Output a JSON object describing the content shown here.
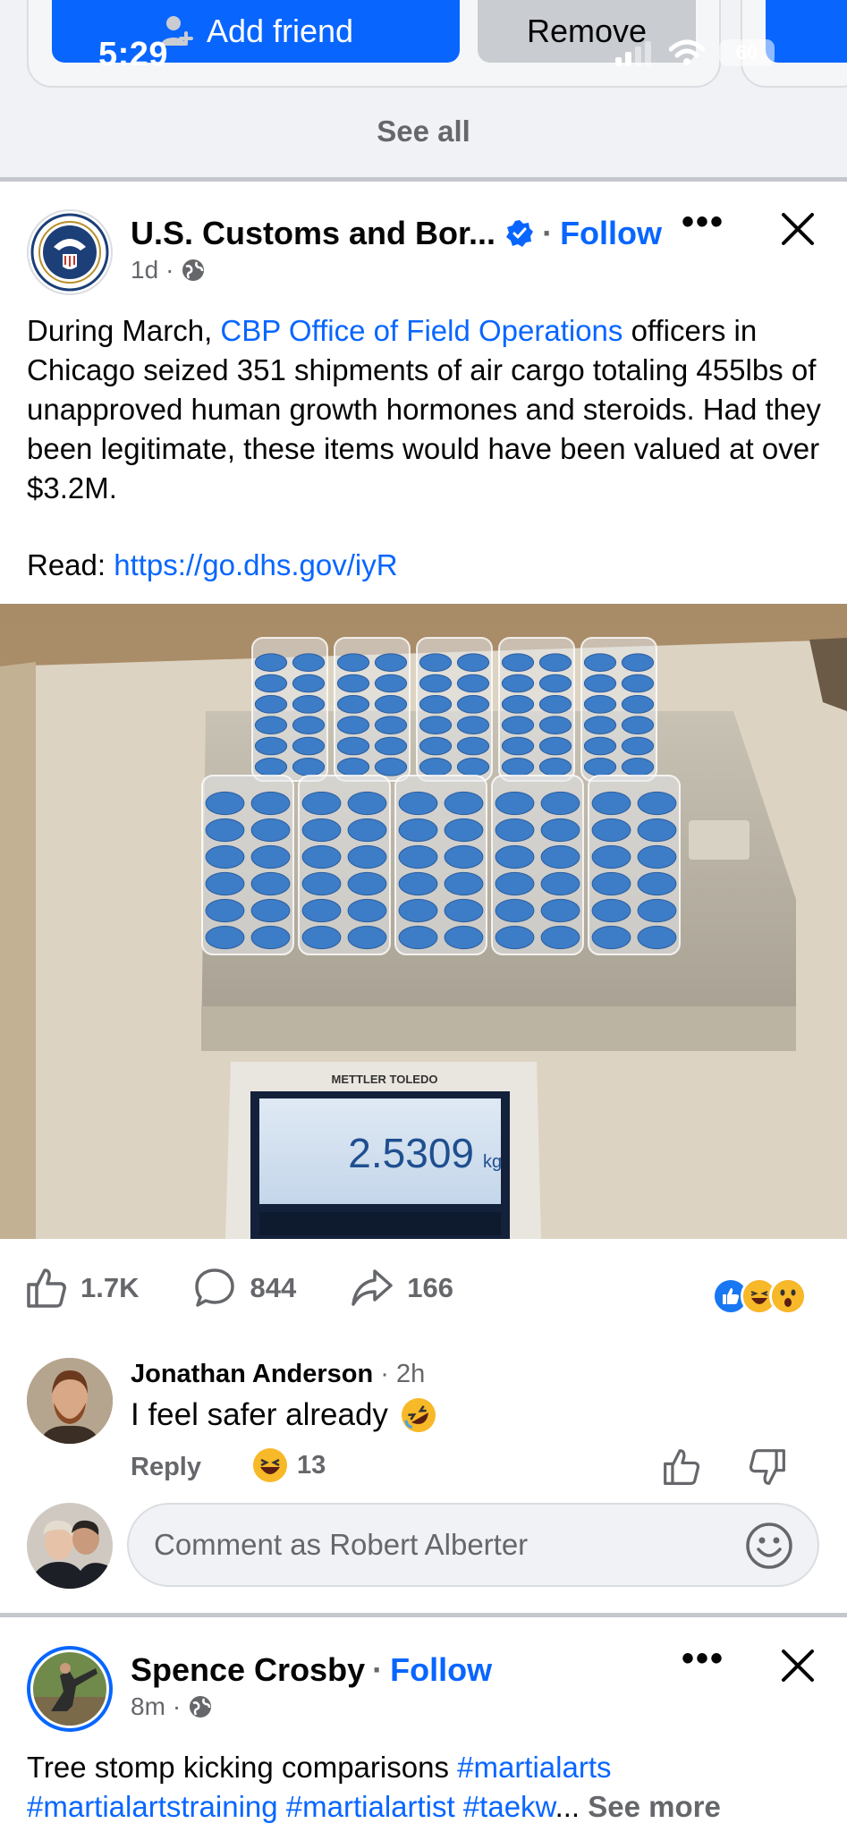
{
  "status_bar": {
    "time": "5:29",
    "battery": "60"
  },
  "suggestion_card": {
    "add_friend_label": "Add friend",
    "remove_label": "Remove"
  },
  "see_all_label": "See all",
  "post1": {
    "author": "U.S. Customs and Bor...",
    "follow_label": "Follow",
    "time": "1d",
    "body_before_link": "During March, ",
    "body_link": "CBP Office of Field Operations",
    "body_after_link": " officers in Chicago seized 351 shipments of air cargo totaling 455lbs of unapproved human growth hormones and steroids. Had they been legitimate, these items would have been valued at over $3.2M.",
    "read_label": "Read: ",
    "read_url": "https://go.dhs.gov/iyR",
    "scale_brand": "METTLER TOLEDO",
    "scale_reading": "2.5309",
    "scale_unit": "kg",
    "likes": "1.7K",
    "comments": "844",
    "shares": "166",
    "top_comment": {
      "name": "Jonathan Anderson",
      "time": "2h",
      "text": "I feel safer already",
      "reply_label": "Reply",
      "reaction_count": "13"
    },
    "comment_placeholder": "Comment as Robert Alberter"
  },
  "post2": {
    "author": "Spence Crosby",
    "follow_label": "Follow",
    "time": "8m",
    "body": "Tree stomp kicking comparisons ",
    "tags_line1": "#martialarts",
    "tags_line2": "#martialartstraining #martialartist #taekw",
    "see_more_label": "See more"
  },
  "colors": {
    "accent": "#0866ff",
    "secondary_text": "#65676b",
    "divider": "#c4c7cc"
  }
}
